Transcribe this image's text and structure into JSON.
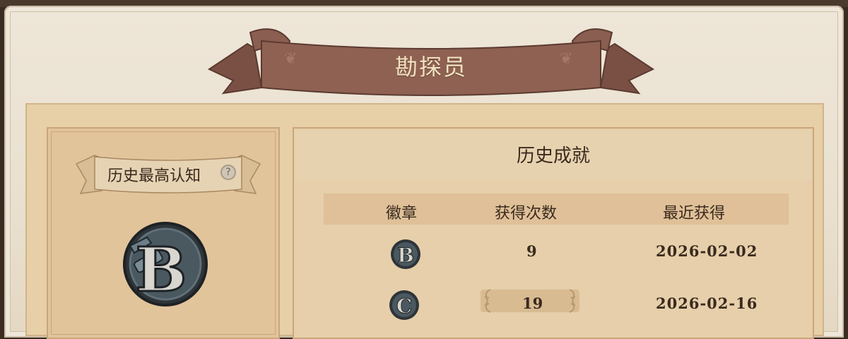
{
  "banner": {
    "title": "勘探员"
  },
  "left": {
    "label": "历史最高认知",
    "help_icon": "question-icon",
    "badge_letter": "B"
  },
  "right": {
    "title": "历史成就",
    "headers": [
      "徽章",
      "获得次数",
      "最近获得"
    ],
    "rows": [
      {
        "badge": "B",
        "count": "9",
        "date": "2026-02-02"
      },
      {
        "badge": "C",
        "count": "19",
        "date": "2026-02-16"
      }
    ]
  },
  "colors": {
    "ribbon": "#8a5e50",
    "panel": "#e7cfa7",
    "text": "#3a2a1e"
  }
}
